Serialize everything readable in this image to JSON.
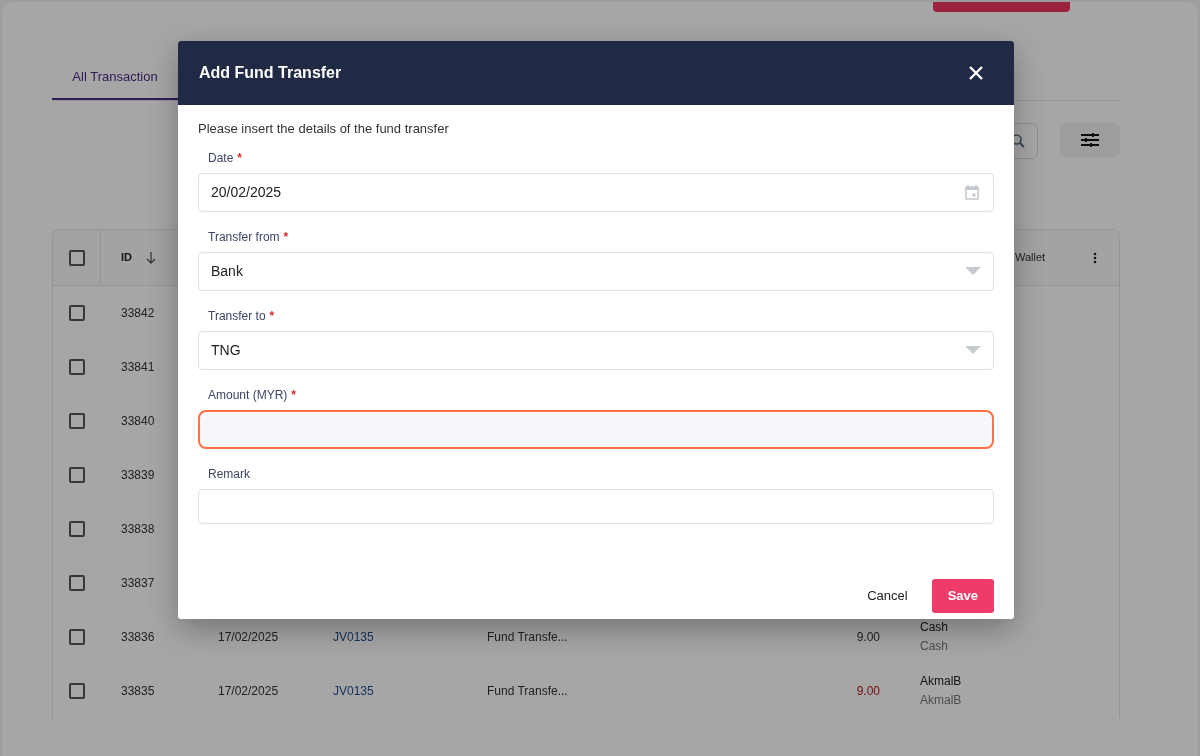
{
  "tabs": [
    {
      "label": "All Transaction",
      "selected": true
    }
  ],
  "table": {
    "all_checked": false,
    "columns": [
      {
        "label": "ID"
      },
      {
        "label": "Wallet"
      }
    ],
    "rows": [
      {
        "checked": false,
        "id": "33842"
      },
      {
        "checked": false,
        "id": "33841"
      },
      {
        "checked": false,
        "id": "33840"
      },
      {
        "checked": false,
        "id": "33839"
      },
      {
        "checked": false,
        "id": "33838"
      },
      {
        "checked": false,
        "id": "33837"
      },
      {
        "checked": false,
        "id": "33836",
        "date": "17/02/2025",
        "reference": "JV0135",
        "description": "Fund Transfe...",
        "amount": "9.00",
        "negative": false,
        "wallet": "Cash",
        "wallet_sub": "Cash"
      },
      {
        "checked": false,
        "id": "33835",
        "date": "17/02/2025",
        "reference": "JV0135",
        "description": "Fund Transfe...",
        "amount": "9.00",
        "negative": true,
        "wallet": "AkmalB",
        "wallet_sub": "AkmalB"
      }
    ]
  },
  "dialog": {
    "title": "Add Fund Transfer",
    "intro": "Please insert the details of the fund transfer",
    "fields": [
      {
        "kind": "date",
        "label": "Date",
        "required_mark": "*",
        "value": "20/02/2025",
        "focused": false
      },
      {
        "kind": "select",
        "label": "Transfer from",
        "required_mark": "*",
        "value": "Bank",
        "focused": false
      },
      {
        "kind": "select",
        "label": "Transfer to",
        "required_mark": "*",
        "value": "TNG",
        "focused": false
      },
      {
        "kind": "text",
        "label": "Amount (MYR)",
        "required_mark": "*",
        "focused": true
      },
      {
        "kind": "text",
        "label": "Remark",
        "focused": false
      }
    ],
    "buttons": [
      {
        "kind": "text",
        "label": "Cancel"
      },
      {
        "kind": "primary",
        "label": "Save"
      }
    ]
  }
}
